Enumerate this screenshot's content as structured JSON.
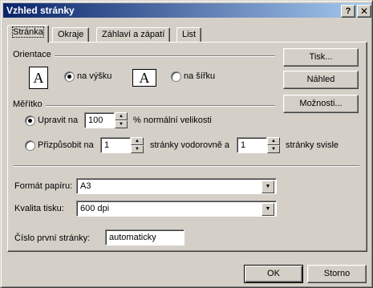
{
  "window": {
    "title": "Vzhled stránky",
    "help_label": "?",
    "close_label": "✕"
  },
  "tabs": [
    {
      "label": "Stránka",
      "active": true
    },
    {
      "label": "Okraje"
    },
    {
      "label": "Záhlaví a zápatí"
    },
    {
      "label": "List"
    }
  ],
  "orientation": {
    "group_label": "Orientace",
    "portrait_icon": "A",
    "landscape_icon": "A",
    "portrait_label": "na výšku",
    "landscape_label": "na šířku",
    "selected": "portrait"
  },
  "scale": {
    "group_label": "Měřítko",
    "adjust_label": "Upravit na",
    "adjust_value": "100",
    "adjust_suffix": "% normální velikosti",
    "fit_label": "Přizpůsobit na",
    "fit_wide_value": "1",
    "fit_wide_suffix": "stránky vodorovně a",
    "fit_tall_value": "1",
    "fit_tall_suffix": "stránky svisle",
    "selected": "adjust"
  },
  "paper": {
    "size_label": "Formát papíru:",
    "size_value": "A3",
    "quality_label": "Kvalita tisku:",
    "quality_value": "600 dpi",
    "first_page_label": "Číslo první stránky:",
    "first_page_value": "automaticky"
  },
  "side_buttons": {
    "print": "Tisk...",
    "preview": "Náhled",
    "options": "Možnosti..."
  },
  "footer": {
    "ok": "OK",
    "cancel": "Storno"
  },
  "colors": {
    "face": "#d4d0c8",
    "title_start": "#0a246a",
    "title_end": "#a6caf0"
  }
}
